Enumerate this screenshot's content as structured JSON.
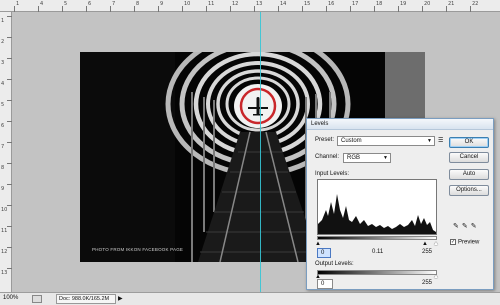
{
  "ruler": {
    "top_ticks": [
      "1",
      "4",
      "5",
      "6",
      "7",
      "8",
      "9",
      "10",
      "11",
      "12",
      "13",
      "14",
      "15",
      "16",
      "17",
      "18",
      "19",
      "20",
      "21",
      "22"
    ],
    "left_ticks": [
      "1",
      "2",
      "3",
      "4",
      "5",
      "6",
      "7",
      "8",
      "9",
      "10",
      "11",
      "12",
      "13"
    ]
  },
  "photo": {
    "caption": "PHOTO FROM IKKON FACEBOOK PAGE"
  },
  "status_bar": {
    "zoom": "100%",
    "doc": "Doc: 988.0K/165.2M",
    "arrow": "▶"
  },
  "levels_dialog": {
    "title": "Levels",
    "preset_label": "Preset:",
    "preset_value": "Custom",
    "channel_label": "Channel:",
    "channel_value": "RGB",
    "input_levels_label": "Input Levels:",
    "input_values": [
      "0",
      "0.11",
      "255"
    ],
    "output_levels_label": "Output Levels:",
    "output_values": [
      "0",
      "255"
    ],
    "buttons": {
      "ok": "OK",
      "cancel": "Cancel",
      "auto": "Auto",
      "options": "Options..."
    },
    "preview_label": "Preview",
    "preview_checked": true
  },
  "colors": {
    "guide": "#36c6d6",
    "highlight_circle": "#c9262a",
    "dialog_border": "#7a9dc0"
  }
}
